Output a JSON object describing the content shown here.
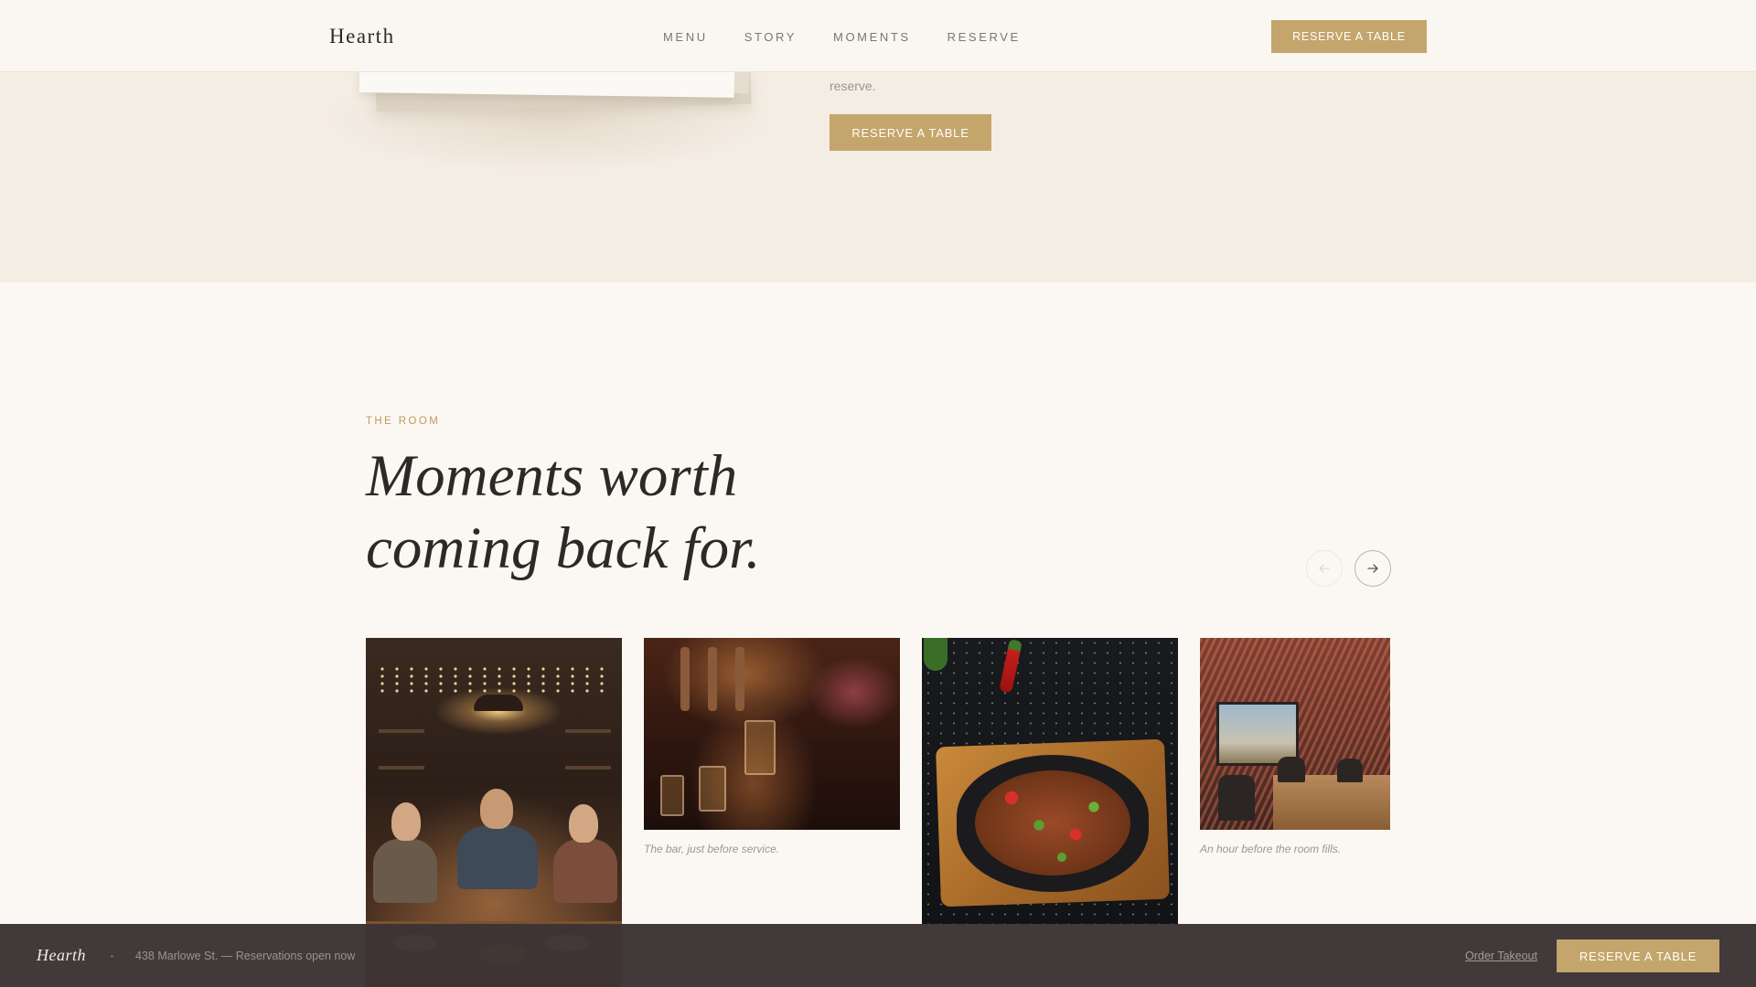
{
  "nav": {
    "brand": "Hearth",
    "links": [
      "MENU",
      "STORY",
      "MOMENTS",
      "RESERVE"
    ],
    "cta": "RESERVE A TABLE"
  },
  "hero": {
    "text_fragment": "reserve.",
    "cta": "RESERVE A TABLE"
  },
  "moments": {
    "eyebrow": "THE ROOM",
    "title_line1": "Moments worth",
    "title_line2": "coming back for.",
    "prev_icon": "arrow-left-icon",
    "next_icon": "arrow-right-icon",
    "photos": [
      {
        "subject": "friends-dinner-party",
        "caption": ""
      },
      {
        "subject": "bartender-pouring-drinks",
        "caption": "The bar, just before service."
      },
      {
        "subject": "sizzling-stir-fry-skillet",
        "caption": ""
      },
      {
        "subject": "restaurant-interior",
        "caption": "An hour before the room fills."
      }
    ]
  },
  "bottom_bar": {
    "brand": "Hearth",
    "address": "438 Marlowe St. — Reservations open now",
    "link": "Order Takeout",
    "cta": "RESERVE A TABLE"
  },
  "colors": {
    "accent_gold": "#c4a56b",
    "eyebrow_gold": "#c09a5c",
    "background": "#fbf8f3",
    "hero_background": "#f4ede4",
    "bottom_bar": "#3c3434"
  }
}
